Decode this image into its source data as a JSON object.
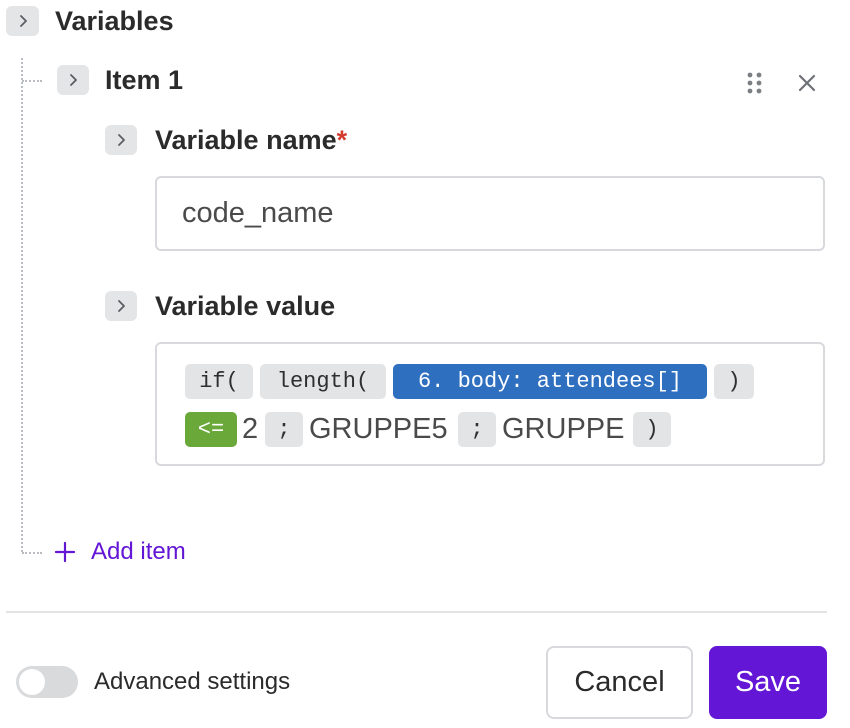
{
  "section": {
    "title": "Variables"
  },
  "item": {
    "title": "Item 1",
    "drag_icon": "drag-handle-icon",
    "close_icon": "close-icon"
  },
  "name_field": {
    "label": "Variable name",
    "required_mark": "*",
    "value": "code_name"
  },
  "value_field": {
    "label": "Variable value",
    "tokens": {
      "if_fn": "if(",
      "length_fn": "length(",
      "ref": "6. body: attendees[]",
      "close_paren_1": ")",
      "operator": "<=",
      "literal_2": "2",
      "sep_1": ";",
      "literal_g5": "GRUPPE5",
      "sep_2": ";",
      "literal_g": "GRUPPE",
      "close_paren_2": ")"
    }
  },
  "add_item": {
    "label": "Add item",
    "icon": "plus-icon"
  },
  "footer": {
    "advanced_label": "Advanced settings",
    "advanced_enabled": false,
    "cancel_label": "Cancel",
    "save_label": "Save"
  },
  "colors": {
    "accent": "#6316d6",
    "ref_token": "#2f6fc0",
    "operator_token": "#6aa83a",
    "required": "#d33b2f"
  }
}
